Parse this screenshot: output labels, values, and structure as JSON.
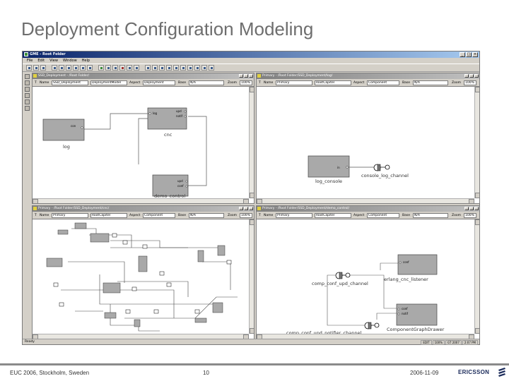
{
  "slide": {
    "title": "Deployment Configuration Modeling",
    "footer_left": "EUC 2006, Stockholm, Sweden",
    "page_number": "10",
    "date": "2006-11-09",
    "brand": "ERICSSON"
  },
  "app": {
    "title": "GME - Root Folder",
    "menu": [
      "File",
      "Edit",
      "View",
      "Window",
      "Help"
    ],
    "status": "Ready",
    "status_cells": [
      "EDIT",
      "100%",
      "GT 2007",
      "2:07 PM"
    ],
    "window_buttons": [
      "_",
      "□",
      "×"
    ]
  },
  "windows": {
    "top_left": {
      "title": "SSD_Deployment - /Root Folder/",
      "name_label": "Name",
      "name_value": "SSD_Deployment",
      "type_value": "DeploymentModel",
      "aspect_label": "Aspect",
      "aspect_value": "Deployment",
      "base_label": "Base",
      "base_value": "N/A",
      "zoom_label": "Zoom",
      "zoom_value": "100%",
      "boxes": [
        {
          "name": "log"
        },
        {
          "name": "cnc"
        },
        {
          "name": "demo_control"
        }
      ]
    },
    "top_right": {
      "title": "Primary - /Root Folder/SSD_Deployment/log/",
      "name_label": "Name",
      "name_value": "Primary",
      "type_value": "RootCapitel",
      "aspect_label": "Aspect",
      "aspect_value": "Component",
      "base_label": "Base",
      "base_value": "N/A",
      "zoom_label": "Zoom",
      "zoom_value": "100%",
      "box_name": "log_console",
      "channel_name": "console_log_channel"
    },
    "bottom_left": {
      "title": "Primary - /Root Folder/SSD_Deployment/cnc/",
      "name_label": "Name",
      "name_value": "Primary",
      "type_value": "RootCapitel",
      "aspect_label": "Aspect",
      "aspect_value": "Component",
      "base_label": "Base",
      "base_value": "N/A",
      "zoom_label": "Zoom",
      "zoom_value": "100%"
    },
    "bottom_right": {
      "title": "Primary - /Root Folder/SSD_Deployment/demo_control/",
      "name_label": "Name",
      "name_value": "Primary",
      "type_value": "RootCapitel",
      "aspect_label": "Aspect",
      "aspect_value": "Component",
      "base_label": "Base",
      "base_value": "N/A",
      "zoom_label": "Zoom",
      "zoom_value": "100%",
      "box1_name": "erlang_cnc_listener",
      "channel1_name": "comp_conf_upd_channel",
      "box2_name": "ComponentGraphDrawer",
      "channel2_name": "comp_conf_upd_notifier_channel"
    }
  },
  "colors": {
    "box_fill": "#a9a9a9",
    "title_active": "#0a246a",
    "slide_title": "#6e6e6e"
  }
}
